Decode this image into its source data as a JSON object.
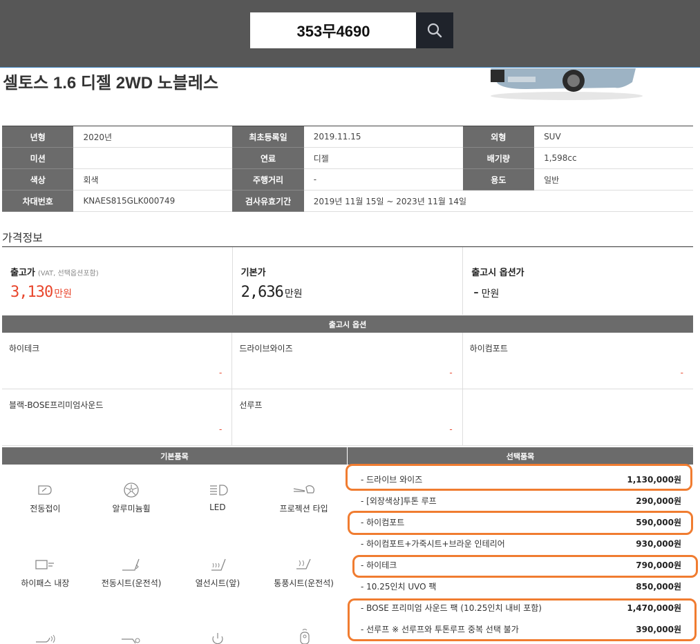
{
  "search": {
    "value": "353무4690",
    "icon": "search-icon"
  },
  "car": {
    "title": "셀토스 1.6 디젤 2WD 노블레스"
  },
  "spec": {
    "rows": [
      [
        {
          "k": "년형",
          "v": "2020년"
        },
        {
          "k": "최초등록일",
          "v": "2019.11.15"
        },
        {
          "k": "외형",
          "v": "SUV"
        }
      ],
      [
        {
          "k": "미션",
          "v": ""
        },
        {
          "k": "연료",
          "v": "디젤"
        },
        {
          "k": "배기량",
          "v": "1,598cc"
        }
      ],
      [
        {
          "k": "색상",
          "v": "회색"
        },
        {
          "k": "주행거리",
          "v": "-"
        },
        {
          "k": "용도",
          "v": "일반"
        }
      ],
      [
        {
          "k": "차대번호",
          "v": "KNAES815GLK000749"
        },
        {
          "k": "검사유효기간",
          "v": "2019년 11월 15일 ~ 2023년 11월 14일"
        }
      ]
    ]
  },
  "price": {
    "section_title": "가격정보",
    "cells": [
      {
        "label": "출고가",
        "note": "(VAT, 선택옵션포함)",
        "value": "3,130",
        "unit": "만원"
      },
      {
        "label": "기본가",
        "note": "",
        "value": "2,636",
        "unit": "만원"
      },
      {
        "label": "출고시 옵션가",
        "note": "",
        "value": "-",
        "unit": "만원"
      }
    ]
  },
  "factory_options": {
    "header": "출고시 옵션",
    "items": [
      {
        "name": "하이테크",
        "price": "-"
      },
      {
        "name": "드라이브와이즈",
        "price": "-"
      },
      {
        "name": "하이컴포트",
        "price": "-"
      },
      {
        "name": "블랙-BOSE프리미엄사운드",
        "price": "-"
      },
      {
        "name": "선루프",
        "price": "-"
      },
      {
        "name": "",
        "price": ""
      }
    ]
  },
  "basic": {
    "header": "기본품목",
    "items": [
      {
        "label": "전동접이",
        "icon": "folding-mirror-icon"
      },
      {
        "label": "알루미늄휠",
        "icon": "alloy-wheel-icon"
      },
      {
        "label": "LED",
        "icon": "led-lamp-icon"
      },
      {
        "label": "프로젝션 타입",
        "icon": "projection-lamp-icon"
      },
      {
        "label": "하이패스 내장",
        "icon": "hipass-icon"
      },
      {
        "label": "전동시트(운전석)",
        "icon": "power-seat-icon"
      },
      {
        "label": "열선시트(앞)",
        "icon": "heated-seat-icon"
      },
      {
        "label": "통풍시트(운전석)",
        "icon": "ventilated-seat-icon"
      }
    ]
  },
  "selected": {
    "header": "선택품목",
    "items": [
      {
        "name": "- 드라이브 와이즈",
        "price": "1,130,000원"
      },
      {
        "name": "- [외장색상]투톤 루프",
        "price": "290,000원"
      },
      {
        "name": "- 하이컴포트",
        "price": "590,000원"
      },
      {
        "name": "- 하이컴포트+가죽시트+브라운 인테리어",
        "price": "930,000원"
      },
      {
        "name": "- 하이테크",
        "price": "790,000원"
      },
      {
        "name": "- 10.25인치 UVO 팩",
        "price": "850,000원"
      },
      {
        "name": "- BOSE 프리미엄 사운드 팩 (10.25인치 내비 포함)",
        "price": "1,470,000원"
      },
      {
        "name": "- 선루프 ※ 선루프와 투톤루프 중복 선택 불가",
        "price": "390,000원"
      }
    ],
    "highlight_color": "#f07c30"
  }
}
